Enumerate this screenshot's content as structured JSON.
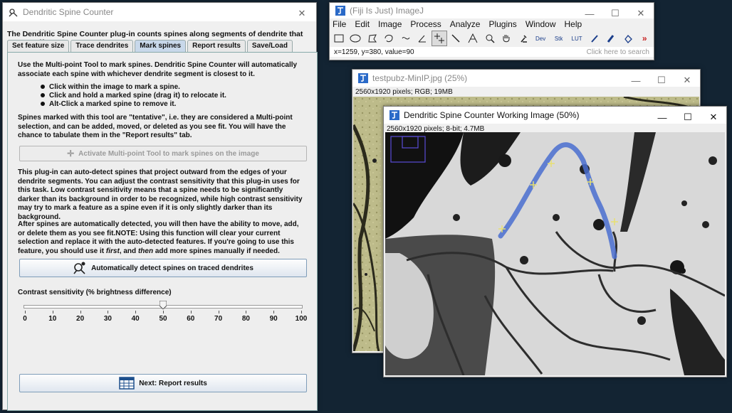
{
  "dialog": {
    "title": "Dendritic Spine Counter",
    "intro": "The Dendritic Spine Counter plug-in counts spines along segments of dendrite that you specify.",
    "tabs": [
      "Set feature size",
      "Trace dendrites",
      "Mark spines",
      "Report results",
      "Save/Load"
    ],
    "active_tab": "Mark spines",
    "para1": "Use the Multi-point Tool to mark spines. Dendritic Spine Counter will automatically associate each spine with whichever dendrite segment is closest to it.",
    "bullets": [
      "Click within the image to mark a spine.",
      "Click and hold a marked spine (drag it) to relocate it.",
      "Alt-Click a marked spine to remove it."
    ],
    "para2": "Spines marked with this tool are \"tentative\", i.e. they are considered a Multi-point selection, and can be added, moved, or deleted as you see fit. You will have the chance to tabulate them in the \"Report results\" tab.",
    "activate_button": "Activate Multi-point Tool to mark spines on the image",
    "para3": "This plug-in can auto-detect spines that project outward from the edges of your dendrite segments. You can adjust the contrast sensitivity that this plug-in uses for this task. Low contrast sensitivity means that a spine needs to be significantly darker than its background in order to be recognized, while high contrast sensitivity may try to mark a feature as a spine even if it is only slightly darker than its background.",
    "para4a": "After spines are automatically detected, you will then have the ability to move, add, or delete them as you see fit.NOTE: Using this function will clear your current selection and replace it with the auto-detected features. If you're going to use this feature, you should use it ",
    "para4_first": "first",
    "para4b": ", and ",
    "para4_then": "then",
    "para4c": " add more spines manually if needed.",
    "auto_button": "Automatically detect spines on traced dendrites",
    "slider_label": "Contrast sensitivity (% brightness difference)",
    "slider_value": 50,
    "slider_ticks": [
      "0",
      "10",
      "20",
      "30",
      "40",
      "50",
      "60",
      "70",
      "80",
      "90",
      "100"
    ],
    "next_button": "Next: Report results"
  },
  "imagej": {
    "title": "(Fiji Is Just) ImageJ",
    "menus": [
      "File",
      "Edit",
      "Image",
      "Process",
      "Analyze",
      "Plugins",
      "Window",
      "Help"
    ],
    "tools": [
      "rectangle-tool",
      "oval-tool",
      "polygon-tool",
      "freehand-tool",
      "line-tool",
      "angle-tool",
      "multipoint-tool",
      "wand-tool",
      "text-tool",
      "magnifier-tool",
      "hand-tool",
      "dropper-tool",
      "Dev",
      "Stk",
      "LUT",
      "pencil-tool",
      "brush-tool",
      "flood-fill-tool",
      "more-tools"
    ],
    "status": "x=1259, y=380, value=90",
    "search_placeholder": "Click here to search"
  },
  "test_window": {
    "title": "testpubz-MinIP.jpg (25%)",
    "info": "2560x1920 pixels; RGB; 19MB"
  },
  "work_window": {
    "title": "Dendritic Spine Counter Working Image (50%)",
    "info": "2560x1920 pixels; 8-bit; 4.7MB"
  },
  "colors": {
    "desktop": "#132433",
    "trace": "#4a6fd0",
    "tab_active": "#c8d8ea",
    "spine_marker": "#e8e070"
  }
}
